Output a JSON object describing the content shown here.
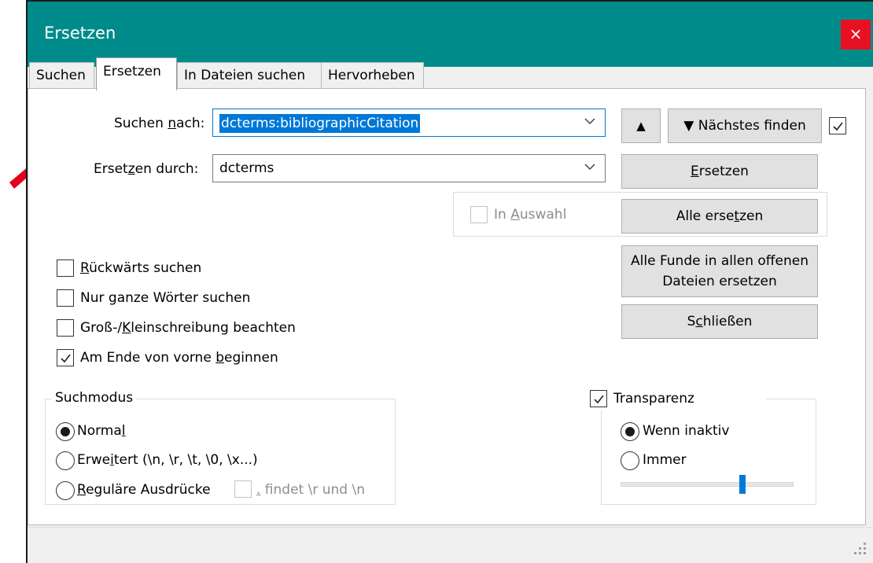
{
  "window": {
    "title": "Ersetzen",
    "close_label": "×"
  },
  "tabs": [
    {
      "label": "Suchen"
    },
    {
      "label": "Ersetzen"
    },
    {
      "label": "In Dateien suchen"
    },
    {
      "label": "Hervorheben"
    }
  ],
  "search": {
    "label_pre": "Suchen ",
    "label_key": "n",
    "label_post": "ach:",
    "value": "dcterms:bibliographicCitation"
  },
  "replace": {
    "label_pre": "Erset",
    "label_key": "z",
    "label_post": "en durch:",
    "value": "dcterms"
  },
  "buttons": {
    "prev": "▲",
    "next": "▼ Nächstes finden",
    "replace_key": "E",
    "replace_rest": "rsetzen",
    "replace_all_pre": "Alle erse",
    "replace_all_key": "t",
    "replace_all_post": "zen",
    "replace_all_open_line1": "Alle Funde in allen offenen",
    "replace_all_open_line2": "Dateien ersetzen",
    "close_pre": "S",
    "close_key": "c",
    "close_post": "hließen"
  },
  "in_selection": {
    "label_pre": "In ",
    "label_key": "A",
    "label_post": "uswahl",
    "checked": false,
    "enabled": false
  },
  "options": {
    "backward": {
      "key": "R",
      "rest": "ückwärts suchen",
      "checked": false
    },
    "whole_words": {
      "pre": "Nur ",
      "key": "g",
      "post": "anze Wörter suchen",
      "checked": false
    },
    "match_case": {
      "pre": "Groß-/",
      "key": "K",
      "post": "leinschreibung beachten",
      "checked": false
    },
    "wrap_around": {
      "pre": "Am Ende von vorne ",
      "key": "b",
      "post": "eginnen",
      "checked": true
    }
  },
  "search_mode": {
    "title": "Suchmodus",
    "normal": {
      "pre": "Norma",
      "key": "l",
      "post": "",
      "selected": true
    },
    "extended": {
      "pre": "Erwe",
      "key": "i",
      "post": "tert (\\n, \\r, \\t, \\0, \\x...)",
      "selected": false
    },
    "regex": {
      "pre": "",
      "key": "R",
      "post": "eguläre Ausdrücke",
      "selected": false
    },
    "dot_newline": {
      "key": ".",
      "post": " findet \\r und \\n",
      "checked": false,
      "enabled": false
    }
  },
  "transparency": {
    "title": "Transparenz",
    "checked": true,
    "when_inactive": {
      "label": "Wenn inaktiv",
      "selected": true
    },
    "always": {
      "label": "Immer",
      "selected": false
    },
    "slider_fraction": 0.71
  },
  "colors": {
    "titlebar": "#008b8b",
    "close": "#e81123",
    "selection": "#0078d7",
    "arrow": "#e3001b"
  }
}
